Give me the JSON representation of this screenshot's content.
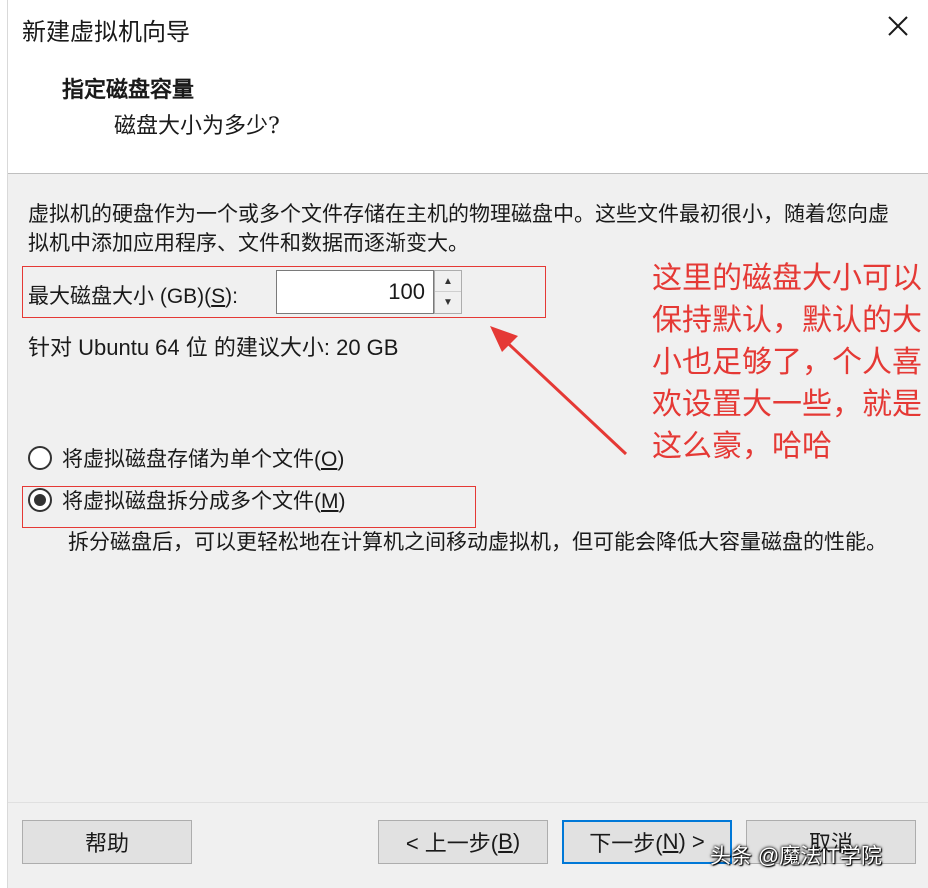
{
  "window": {
    "title": "新建虚拟机向导"
  },
  "header": {
    "title": "指定磁盘容量",
    "subtitle": "磁盘大小为多少?"
  },
  "description": "虚拟机的硬盘作为一个或多个文件存储在主机的物理磁盘中。这些文件最初很小，随着您向虚拟机中添加应用程序、文件和数据而逐渐变大。",
  "disk_size": {
    "label_prefix": "最大磁盘大小 (GB)(",
    "label_key": "S",
    "label_suffix": "):",
    "value": "100"
  },
  "recommendation": "针对 Ubuntu 64 位 的建议大小: 20 GB",
  "options": {
    "single_file": {
      "label_prefix": "将虚拟磁盘存储为单个文件(",
      "label_key": "O",
      "label_suffix": ")",
      "checked": false
    },
    "multi_file": {
      "label_prefix": "将虚拟磁盘拆分成多个文件(",
      "label_key": "M",
      "label_suffix": ")",
      "checked": true
    },
    "multi_file_description": "拆分磁盘后，可以更轻松地在计算机之间移动虚拟机，但可能会降低大容量磁盘的性能。"
  },
  "annotation": {
    "text": "这里的磁盘大小可以保持默认，默认的大小也足够了，个人喜欢设置大一些，就是这么豪，哈哈",
    "color": "#e53935"
  },
  "buttons": {
    "help": "帮助",
    "prev_prefix": "< 上一步(",
    "prev_key": "B",
    "prev_suffix": ")",
    "next_prefix": "下一步(",
    "next_key": "N",
    "next_suffix": ") >",
    "cancel": "取消"
  },
  "watermark": "头条 @魔法IT学院",
  "colors": {
    "accent": "#0078d7",
    "highlight": "#e53935",
    "panel": "#f0f0f0"
  }
}
